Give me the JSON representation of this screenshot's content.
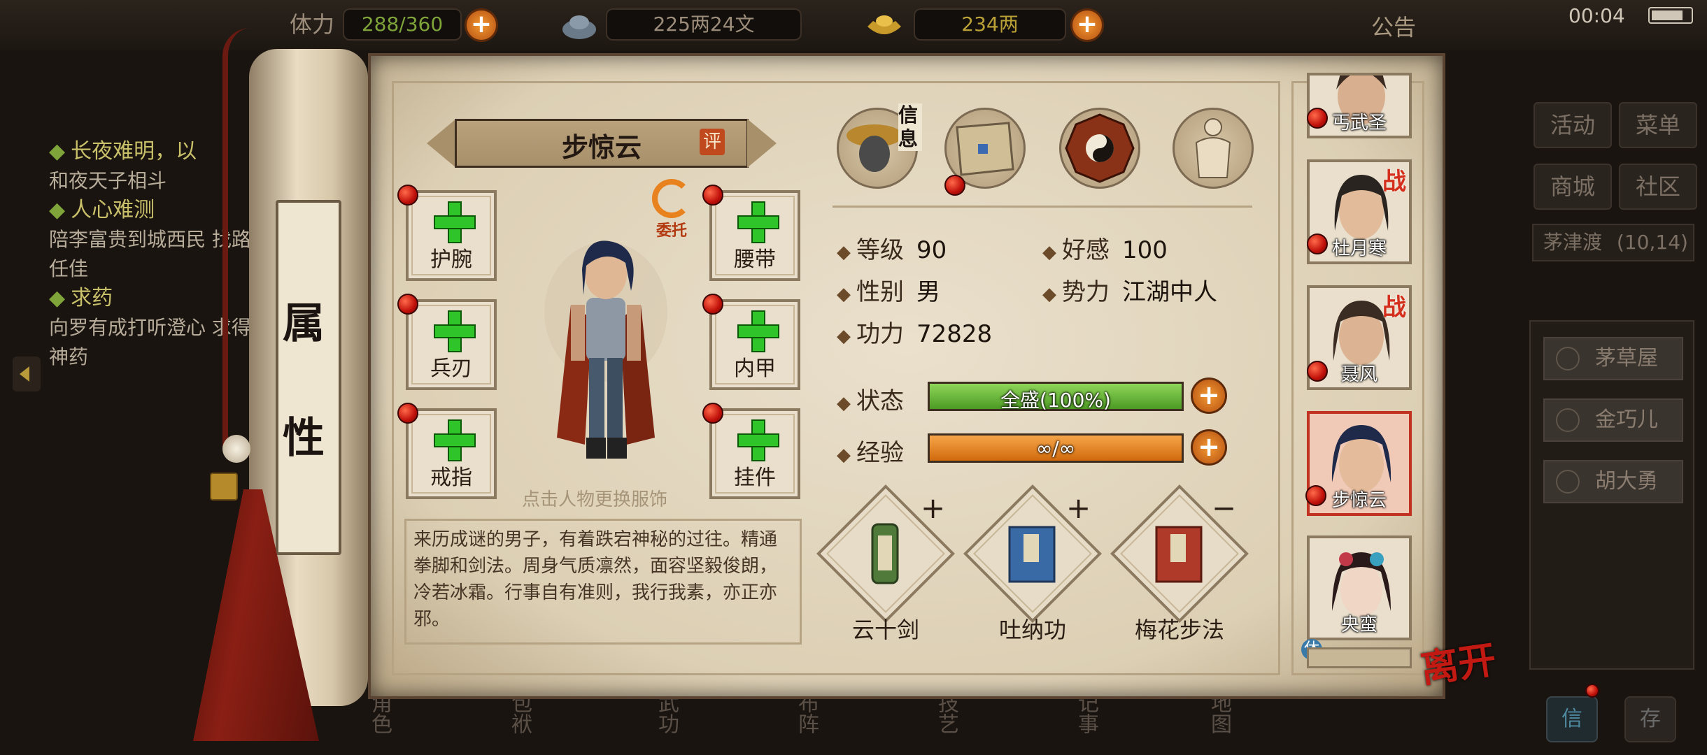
{
  "topbar": {
    "stamina_label": "体力",
    "stamina_value": "288/360",
    "money_value": "225两24文",
    "gold_value": "234两",
    "notice_label": "公告",
    "clock": "00:04",
    "add_label": "+"
  },
  "quests": [
    {
      "title": "长夜难明，以",
      "body": "和夜天子相斗"
    },
    {
      "title": "人心难测",
      "body": "陪李富贵到城西民 找路任佳"
    },
    {
      "title": "求药",
      "body": "向罗有成打听澄心 求得神药"
    }
  ],
  "scroll_title": [
    "属",
    "性"
  ],
  "hero": {
    "name": "步惊云",
    "rate_badge": "评",
    "entrust_label": "委托",
    "hint": "点击人物更换服饰",
    "description": "来历成谜的男子，有着跌宕神秘的过往。精通拳脚和剑法。周身气质凛然，面容坚毅俊朗，冷若冰霜。行事自有准则，我行我素，亦正亦邪。"
  },
  "equipment": {
    "left": [
      "护腕",
      "兵刃",
      "戒指"
    ],
    "right": [
      "腰带",
      "内甲",
      "挂件"
    ]
  },
  "tabs": {
    "info_label": "信息",
    "names": [
      "info-tab",
      "scroll-tab",
      "bagua-tab",
      "body-tab"
    ]
  },
  "stats": {
    "level_label": "等级",
    "level_value": "90",
    "favor_label": "好感",
    "favor_value": "100",
    "gender_label": "性别",
    "gender_value": "男",
    "faction_label": "势力",
    "faction_value": "江湖中人",
    "power_label": "功力",
    "power_value": "72828",
    "status_label": "状态",
    "status_text": "全盛(100%)",
    "status_fraction": 1.0,
    "exp_label": "经验",
    "exp_text": "∞/∞",
    "exp_fraction": 1.0
  },
  "skills": [
    {
      "name": "云十剑",
      "op": "+"
    },
    {
      "name": "吐纳功",
      "op": "+"
    },
    {
      "name": "梅花步法",
      "op": "−"
    }
  ],
  "roster": [
    {
      "name": "丐武圣",
      "battle": ""
    },
    {
      "name": "杜月寒",
      "battle": "战"
    },
    {
      "name": "聂风",
      "battle": "战"
    },
    {
      "name": "步惊云",
      "battle": ""
    },
    {
      "name": "央蛮",
      "battle": ""
    }
  ],
  "roster_tag": "休",
  "leave_label": "离开",
  "right_menu": {
    "activity": "活动",
    "menu": "菜单",
    "mall": "商城",
    "community": "社区",
    "location": "茅津渡",
    "coords": "(10,14)",
    "npcs": [
      "茅草屋",
      "金巧儿",
      "胡大勇"
    ],
    "bottom_buttons": [
      "信",
      "存"
    ]
  },
  "bottom_nav": [
    "角色",
    "包袱",
    "武功",
    "布阵",
    "技艺",
    "记事",
    "地图"
  ],
  "colors": {
    "status_fill": "#6bc13a",
    "exp_fill": "#ef8a1c",
    "red_dot": "#d01a10",
    "plus_orange": "#e8821e"
  }
}
